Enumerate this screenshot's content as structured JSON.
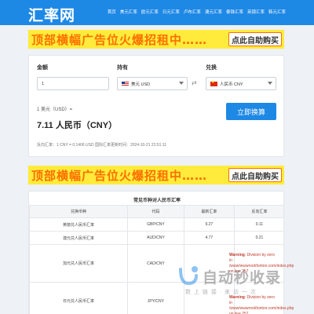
{
  "header": {
    "logo": "汇率网",
    "nav": [
      "首页",
      "美元汇率",
      "欧元汇率",
      "日元汇率",
      "卢布汇率",
      "澳元汇率",
      "泰铢汇率",
      "英镑汇率",
      "韩元汇率"
    ]
  },
  "ads": [
    {
      "text": "顶部横幅广告位火爆招租中……",
      "button": "点此自助购买"
    },
    {
      "text": "顶部横幅广告位火爆招租中……",
      "button": "点此自助购买"
    }
  ],
  "converter": {
    "amount_label": "金额",
    "amount_value": "1",
    "from_label": "持有",
    "from_value": "美元 USD",
    "to_label": "兑换",
    "to_value": "人民币 CNY",
    "rate_line": "1 美元（USD）=",
    "result": "7.11 人民币（CNY）",
    "convert_button": "立即换算",
    "footer": "反向汇率：1 CNY = 0.1406 USD  国际汇率更新时间：2024-10-21 22:51:11"
  },
  "table": {
    "title": "常见币种对人民币汇率",
    "headers": [
      "兑换币种",
      "代码",
      "最新汇率",
      "反向汇率"
    ],
    "rows": [
      [
        "英镑兑人民币汇率",
        "GBP/CNY",
        "9.27",
        "0.11"
      ],
      [
        "澳元兑人民币汇率",
        "AUD/CNY",
        "4.77",
        "0.21"
      ],
      [
        "加元兑人民币汇率",
        "CAD/CNY",
        "",
        ""
      ],
      [
        "日元兑人民币汇率",
        "JPY/CNY",
        "",
        ""
      ]
    ]
  },
  "warnings": [
    {
      "title": "Warning",
      "text": ": Division by zero in /www/wwwroot/tonton.com/index.php on line 257"
    },
    {
      "title": "Warning",
      "text": ": Division by zero in /www/wwwroot/tonton.com/index.php on line 257"
    }
  ],
  "watermark": {
    "brand": "自动秒收录",
    "sub": "数 上 链 接 · 来 访 一 次"
  },
  "colors": {
    "primary": "#1e88e5",
    "ad_bg": "#ffeb3b",
    "ad_text": "#ff6f00"
  }
}
